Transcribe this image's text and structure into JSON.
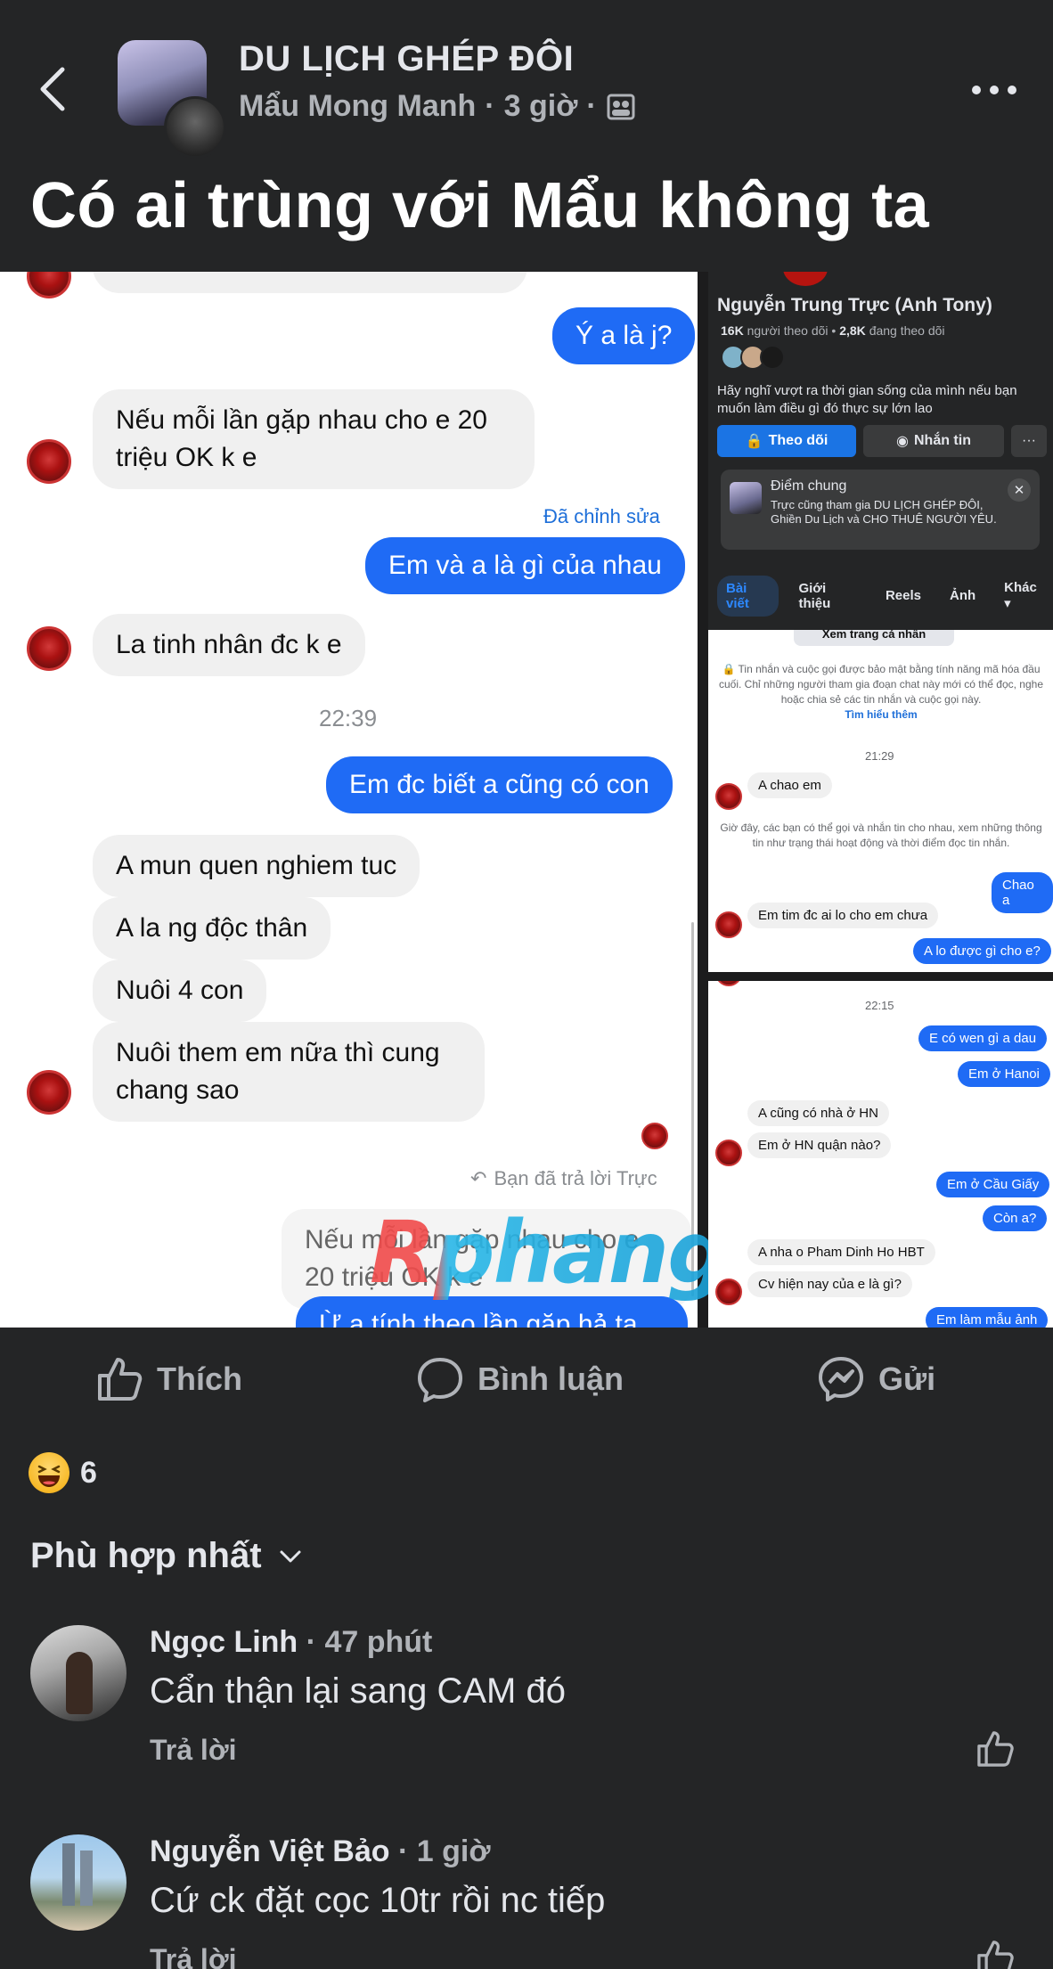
{
  "header": {
    "group_name": "DU LỊCH GHÉP ĐÔI",
    "author": "Mẩu Mong Manh",
    "time": "3 giờ",
    "separator": "·",
    "post_title": "Có ai trùng với Mẩu không ta"
  },
  "left_chat": {
    "msg_out_1": "Ý a là j?",
    "msg_in_1": "Nếu mỗi lần gặp nhau cho e 20 triệu OK k e",
    "edited_label": "Đã chỉnh sửa",
    "msg_out_2": "Em và a là gì của nhau",
    "msg_in_2": "La tinh nhân đc k e",
    "time": "22:39",
    "msg_out_3": "Em đc biết a cũng có con",
    "msg_in_3": "A mun quen nghiem tuc",
    "msg_in_4": "A la ng độc thân",
    "msg_in_5": "Nuôi 4 con",
    "msg_in_6": "Nuôi them em nữa thì cung chang sao",
    "replied_label": "Bạn đã trả lời Trực",
    "quoted": "Nếu mỗi lần gặp nhau cho e 20 triệu OK k e",
    "cut_off": "Ừ a tính theo lần gặp hả ta"
  },
  "watermark": "Rphang",
  "profile": {
    "name": "Nguyễn Trung Trực (Anh Tony)",
    "followers_count": "16K",
    "followers_label": "người theo dõi",
    "following_count": "2,8K",
    "following_label": "đang theo dõi",
    "bio": "Hãy nghĩ vượt ra thời gian sống của mình nếu bạn muốn làm điều gì đó thực sự lớn lao",
    "follow_button": "Theo dõi",
    "message_button": "Nhắn tin",
    "more_button": "···",
    "common_title": "Điểm chung",
    "common_text": "Trực cũng tham gia DU LỊCH GHÉP ĐÔI, Ghiền Du Lịch và CHO THUÊ NGƯỜI YÊU.",
    "tabs": [
      "Bài viết",
      "Giới thiệu",
      "Reels",
      "Ảnh",
      "Khác"
    ]
  },
  "mid_chat": {
    "view_profile": "Xem trang cá nhân",
    "e2e_note": "Tin nhắn và cuộc gọi được bảo mật bằng tính năng mã hóa đầu cuối. Chỉ những người tham gia đoạn chat này mới có thể đọc, nghe hoặc chia sẻ các tin nhắn và cuộc gọi này.",
    "learn_more": "Tìm hiểu thêm",
    "time": "21:29",
    "in_1": "A chao em",
    "status_note": "Giờ đây, các bạn có thể gọi và nhắn tin cho nhau, xem những thông tin như trạng thái hoạt động và thời điểm đọc tin nhắn.",
    "out_1": "Chao a",
    "in_2": "Em tim đc ai lo cho em chưa",
    "out_2": "A lo được gì cho e?"
  },
  "bot_chat": {
    "time": "22:15",
    "out_1": "E có wen gì a dau",
    "out_2": "Em ở Hanoi",
    "in_1": "A cũng có nhà ở HN",
    "in_2": "Em ở HN quận nào?",
    "out_3": "Em ở Cầu Giấy",
    "out_4": "Còn a?",
    "in_3": "A nha o Pham Dinh Ho HBT",
    "in_4": "Cv hiện nay của e là gì?",
    "out_5": "Em làm mẫu ảnh"
  },
  "actions": {
    "like": "Thích",
    "comment": "Bình luận",
    "send": "Gửi"
  },
  "reactions": {
    "icon": "haha-emoji",
    "count": "6"
  },
  "sort_label": "Phù hợp nhất",
  "comments": [
    {
      "name": "Ngọc Linh",
      "time": "47 phút",
      "text": "Cẩn thận lại sang CAM đó",
      "reply": "Trả lời"
    },
    {
      "name": "Nguyễn Việt Bảo",
      "time": "1 giờ",
      "text": "Cứ ck đặt cọc 10tr rồi nc tiếp",
      "reply": "Trả lời"
    }
  ],
  "colors": {
    "background": "#242526",
    "messenger_blue": "#1f6bf5",
    "text_primary": "#e4e6eb",
    "text_secondary": "#b0b3b8"
  }
}
